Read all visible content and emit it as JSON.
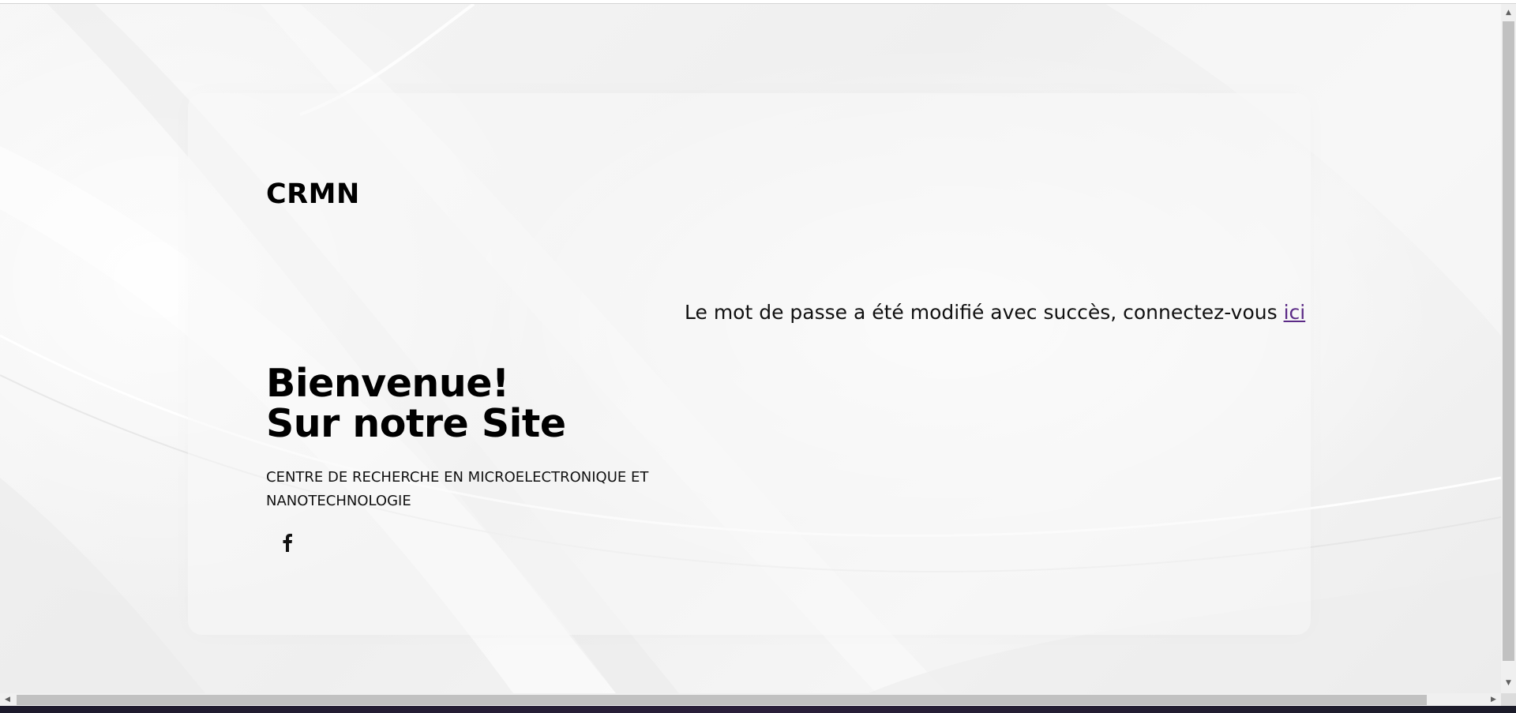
{
  "brand": "CRMN",
  "hero": {
    "line1": "Bienvenue!",
    "line2": "Sur notre Site",
    "tagline": "CENTRE DE RECHERCHE EN MICROELECTRONIQUE ET NANOTECHNOLOGIE"
  },
  "social": {
    "facebook_icon": "facebook-icon",
    "facebook_glyph": "f"
  },
  "message": {
    "text": "Le mot de passe a été modifié avec succès, connectez-vous ",
    "link_label": "ici",
    "link_color": "#5b2a86"
  },
  "scrollbar": {
    "up_arrow": "▲",
    "down_arrow": "▼",
    "left_arrow": "◀",
    "right_arrow": "▶"
  }
}
